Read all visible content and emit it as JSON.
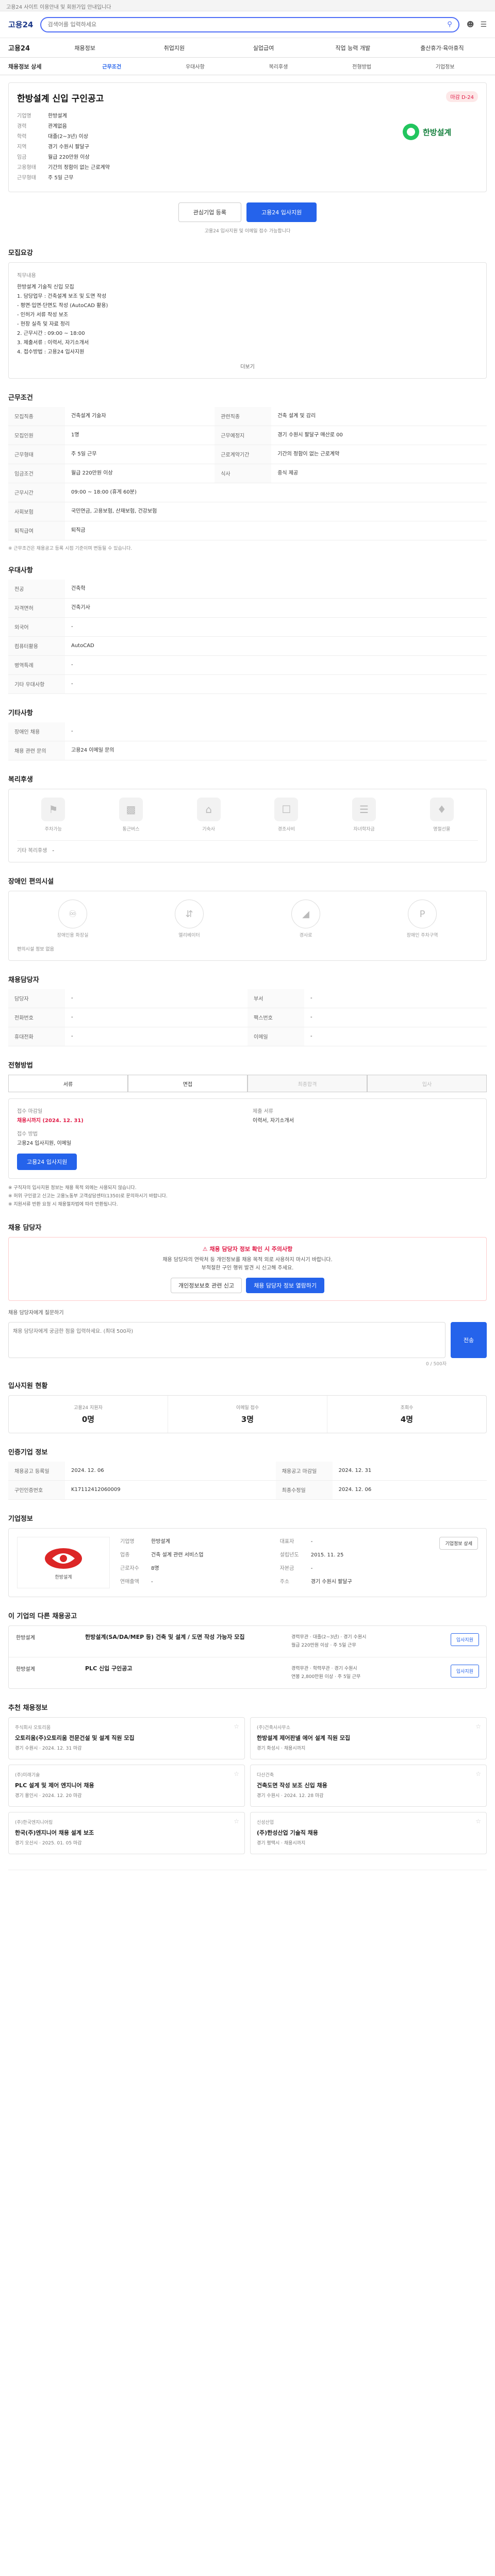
{
  "topbar": {
    "text": "고용24 사이트 이용안내 및 회원가입 안내입니다"
  },
  "header": {
    "logo": "고용24",
    "search_placeholder": "검색어를 입력하세요"
  },
  "gnb": {
    "home": "고용24",
    "items": [
      "채용정보",
      "취업지원",
      "실업급여",
      "직업 능력 개발",
      "출산휴가·육아휴직"
    ]
  },
  "tabs": {
    "title": "채용정보 상세",
    "items": [
      "근무조건",
      "우대사항",
      "복리후생",
      "전형방법",
      "기업정보"
    ]
  },
  "job": {
    "title": "한방설계 신입 구인공고",
    "badge": "마감 D-24",
    "company_label": "기업명",
    "company": "한방설계",
    "rows": [
      {
        "k": "경력",
        "v": "관계없음"
      },
      {
        "k": "학력",
        "v": "대졸(2~3년) 이상"
      },
      {
        "k": "지역",
        "v": "경기 수원시 팔달구"
      },
      {
        "k": "임금",
        "v": "월급 220만원 이상"
      },
      {
        "k": "고용형태",
        "v": "기간의 정함이 없는 근로계약"
      },
      {
        "k": "근무형태",
        "v": "주 5일 근무"
      }
    ],
    "logo_text": "한방설계"
  },
  "actions": {
    "interest": "관심기업 등록",
    "apply": "고용24 입사지원",
    "note": "고용24 입사지원 및 이메일 접수 가능합니다"
  },
  "section_titles": {
    "overview": "모집요강",
    "conditions": "근무조건",
    "preference": "우대사항",
    "etc": "기타사항",
    "welfare": "복리후생",
    "disabled": "장애인 편의시설",
    "contact": "채용담당자",
    "method": "전형방법",
    "report": "채용 담당자",
    "interest": "입사지원 현황",
    "apply_info": "인증기업 정보",
    "company": "기업정보",
    "similar": "이 기업의 다른 채용공고",
    "recommend": "추천 채용정보"
  },
  "overview": {
    "duty_label": "직무내용",
    "duty": "한방설계 기술직 신입 모집\n1. 담당업무 : 건축설계 보조 및 도면 작성\n - 평면·입면·단면도 작성 (AutoCAD 활용)\n - 인허가 서류 작성 보조\n - 현장 실측 및 자료 정리\n2. 근무시간 : 09:00 ~ 18:00\n3. 제출서류 : 이력서, 자기소개서\n4. 접수방법 : 고용24 입사지원",
    "more": "더보기"
  },
  "conditions": [
    {
      "k": "모집직종",
      "v": "건축설계 기술자"
    },
    {
      "k": "관련직종",
      "v": "건축 설계 및 감리"
    },
    {
      "k": "모집인원",
      "v": "1명"
    },
    {
      "k": "근무예정지",
      "v": "경기 수원시 팔달구 매산로 00"
    },
    {
      "k": "근무형태",
      "v": "주 5일 근무"
    },
    {
      "k": "근로계약기간",
      "v": "기간의 정함이 없는 근로계약"
    },
    {
      "k": "임금조건",
      "v": "월급 220만원 이상"
    },
    {
      "k": "식사",
      "v": "중식 제공"
    },
    {
      "k": "근무시간",
      "v": "09:00 ~ 18:00 (휴게 60분)"
    },
    {
      "k": "사회보험",
      "v": "국민연금, 고용보험, 산재보험, 건강보험"
    },
    {
      "k": "퇴직급여",
      "v": "퇴직금"
    }
  ],
  "cond_note": "※ 근무조건은 채용공고 등록 시점 기준이며 변동될 수 있습니다.",
  "preference": [
    {
      "k": "전공",
      "v": "건축학"
    },
    {
      "k": "자격면허",
      "v": "건축기사"
    },
    {
      "k": "외국어",
      "v": "-"
    },
    {
      "k": "컴퓨터활용",
      "v": "AutoCAD"
    },
    {
      "k": "병역특례",
      "v": "-"
    },
    {
      "k": "기타 우대사항",
      "v": "-"
    }
  ],
  "etc": [
    {
      "k": "장애인 채용",
      "v": "-"
    },
    {
      "k": "채용 관련 문의",
      "v": "고용24 이메일 문의"
    }
  ],
  "welfare": {
    "items": [
      "주차가능",
      "통근버스",
      "기숙사",
      "경조사비",
      "자녀학자금",
      "명절선물"
    ],
    "etc_label": "기타 복리후생",
    "etc": "-"
  },
  "disabled": {
    "items": [
      "장애인용 화장실",
      "엘리베이터",
      "경사로",
      "장애인 주차구역"
    ],
    "note": "편의시설 정보 없음"
  },
  "contact": [
    {
      "k": "담당자",
      "v": "-"
    },
    {
      "k": "부서",
      "v": "-"
    },
    {
      "k": "전화번호",
      "v": "-"
    },
    {
      "k": "팩스번호",
      "v": "-"
    },
    {
      "k": "휴대전화",
      "v": "-"
    },
    {
      "k": "이메일",
      "v": "-"
    }
  ],
  "method": {
    "steps": [
      "서류",
      "면접",
      "최종합격",
      "입사"
    ],
    "deadline_label": "접수 마감일",
    "deadline": "채용시까지 (2024. 12. 31)",
    "how_label": "접수 방법",
    "how": "고용24 입사지원, 이메일",
    "docs_label": "제출 서류",
    "docs": "이력서, 자기소개서",
    "apply_btn": "고용24 입사지원",
    "notes": [
      "※ 구직자의 입사지원 정보는 채용 목적 외에는 사용되지 않습니다.",
      "※ 허위 구인광고 신고는 고용노동부 고객상담센터(1350)로 문의하시기 바랍니다.",
      "※ 지원서류 반환 요청 시 채용절차법에 따라 반환됩니다."
    ]
  },
  "report": {
    "warn_title": "채용 담당자 정보 확인 시 주의사항",
    "warn": "채용 담당자의 연락처 등 개인정보를 채용 목적 외로 사용하지 마시기 바랍니다.\n부적절한 구인 행위 발견 시 신고해 주세요.",
    "btn1": "개인정보보호 관련 신고",
    "btn2": "채용 담당자 정보 열람하기",
    "label": "채용 담당자에게 질문하기",
    "placeholder": "채용 담당자에게 궁금한 점을 입력하세요. (최대 500자)",
    "count": "0 / 500자",
    "send": "전송"
  },
  "interest": {
    "label": "지원자 현황",
    "stats": [
      {
        "l": "고용24 지원자",
        "v": "0명"
      },
      {
        "l": "이메일 접수",
        "v": "3명"
      },
      {
        "l": "조회수",
        "v": "4명"
      }
    ]
  },
  "apply_info": [
    {
      "k": "채용공고 등록일",
      "v": "2024. 12. 06"
    },
    {
      "k": "채용공고 마감일",
      "v": "2024. 12. 31"
    },
    {
      "k": "구인인증번호",
      "v": "K17112412060009"
    },
    {
      "k": "최종수정일",
      "v": "2024. 12. 06"
    }
  ],
  "company": {
    "name": "한방설계",
    "rows": [
      {
        "k": "기업명",
        "v": "한방설계"
      },
      {
        "k": "대표자",
        "v": "-"
      },
      {
        "k": "업종",
        "v": "건축 설계 관련 서비스업"
      },
      {
        "k": "설립년도",
        "v": "2015. 11. 25"
      },
      {
        "k": "근로자수",
        "v": "8명"
      },
      {
        "k": "자본금",
        "v": "-"
      },
      {
        "k": "연매출액",
        "v": "-"
      },
      {
        "k": "주소",
        "v": "경기 수원시 팔달구"
      }
    ],
    "btn": "기업정보 상세"
  },
  "similar": [
    {
      "c": "한방설계",
      "t": "한방설계(SA/DA/MEP 등) 건축 및 설계 / 도면 작성 가능자 모집",
      "m": "경력무관 · 대졸(2~3년) · 경기 수원시\n월급 220만원 이상 · 주 5일 근무",
      "btn": "입사지원"
    },
    {
      "c": "한방설계",
      "t": "PLC 신입 구인공고",
      "m": "경력무관 · 학력무관 · 경기 수원시\n연봉 2,800만원 이상 · 주 5일 근무",
      "btn": "입사지원"
    }
  ],
  "recommend": [
    {
      "c": "주식회사 오토리움",
      "t": "오토리움(주)오토리움 전문건설 및 설계 직원 모집",
      "m": "경기 수원시 · 2024. 12. 31 마감"
    },
    {
      "c": "(주)건축사사무소",
      "t": "한방설계 제어판넬 에어 설계 직원 모집",
      "m": "경기 화성시 · 채용시까지"
    },
    {
      "c": "(주)미래기술",
      "t": "PLC 설계 및 제어 엔지니어 채용",
      "m": "경기 용인시 · 2024. 12. 20 마감"
    },
    {
      "c": "다산건축",
      "t": "건축도면 작성 보조 신입 채용",
      "m": "경기 수원시 · 2024. 12. 28 마감"
    },
    {
      "c": "(주)한국엔지니어링",
      "t": "한국(주)엔지니어 채용 설계 보조",
      "m": "경기 오산시 · 2025. 01. 05 마감"
    },
    {
      "c": "신성산업",
      "t": "(주)한성산업 기술직 채용",
      "m": "경기 평택시 · 채용시까지"
    }
  ]
}
